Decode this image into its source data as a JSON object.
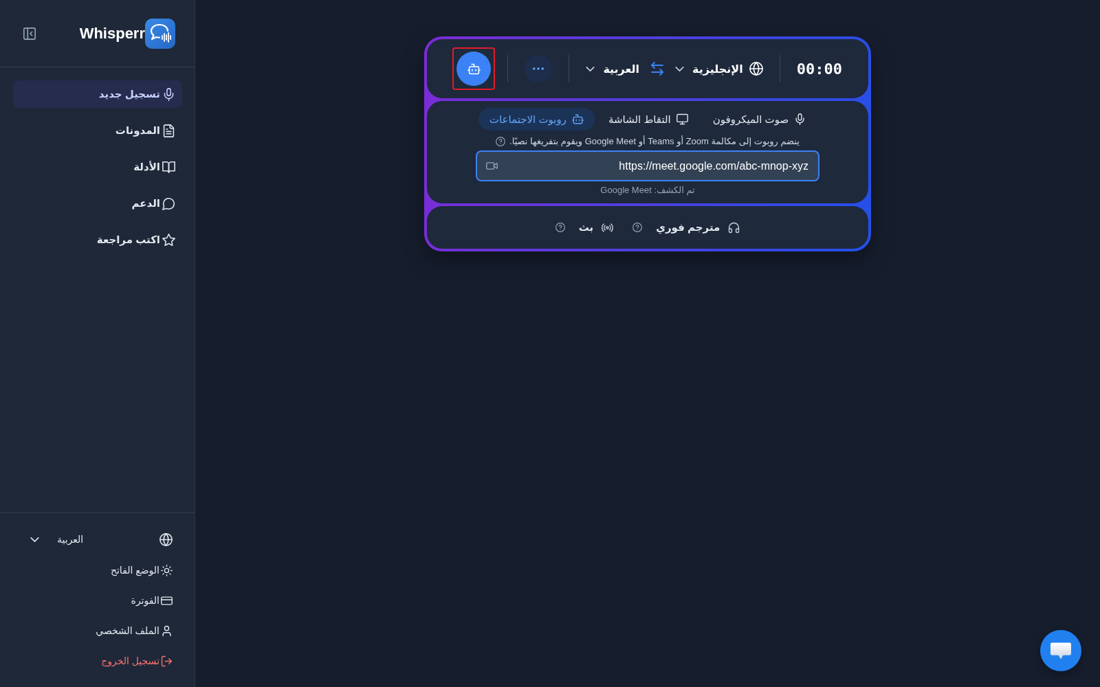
{
  "sidebar": {
    "logo_text": "Whisperr",
    "nav_items": [
      {
        "label": "تسجيل جديد",
        "selected": true
      },
      {
        "label": "المدونات",
        "selected": false
      },
      {
        "label": "الأدلة",
        "selected": false
      },
      {
        "label": "الدعم",
        "selected": false
      },
      {
        "label": "اكتب مراجعة",
        "selected": false
      }
    ],
    "language_select": {
      "value": "العربية"
    },
    "footer_items": [
      {
        "label": "الوضع الفاتح",
        "kind": "setting"
      },
      {
        "label": "الفوترة",
        "kind": "setting"
      },
      {
        "label": "الملف الشخصي",
        "kind": "setting"
      },
      {
        "label": "تسجيل الخروج",
        "kind": "danger"
      }
    ]
  },
  "recorder": {
    "timer": "00:00",
    "source_language": "الإنجليزية",
    "target_language": "العربية",
    "bot_button": {
      "highlighted": true
    },
    "source_tabs": [
      {
        "label": "صوت الميكروفون",
        "selected": false
      },
      {
        "label": "التقاط الشاشة",
        "selected": false
      },
      {
        "label": "روبوت الاجتماعات",
        "selected": true
      }
    ],
    "hint": "ينضم روبوت إلى مكالمة Zoom أو Teams أو Google Meet ويقوم بتفريغها نصيًا.",
    "meeting_url": {
      "value": "https://meet.google.com/abc-mnop-xyz"
    },
    "detected": "تم الكشف: Google Meet",
    "features": [
      {
        "label": "مترجم فوري"
      },
      {
        "label": "بث"
      }
    ]
  }
}
